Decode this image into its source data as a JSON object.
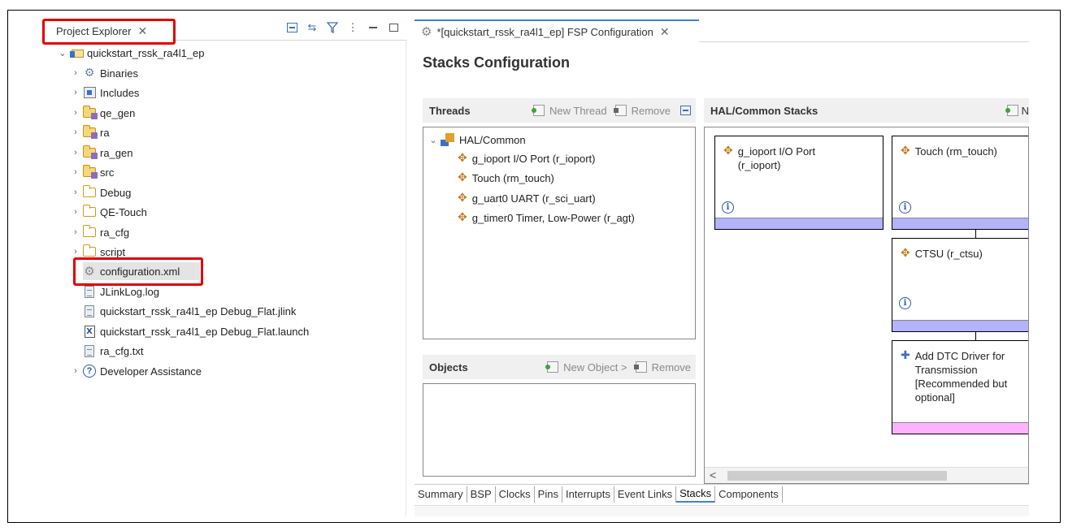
{
  "project_explorer": {
    "tab_label": "Project Explorer",
    "close_glyph": "✕",
    "toolbar_icons": [
      "collapse-all-icon",
      "link-with-editor-icon",
      "filter-icon",
      "view-menu-icon",
      "minimize-icon",
      "maximize-icon"
    ],
    "tree": [
      {
        "label": "quickstart_rssk_ra4l1_ep",
        "icon": "project-icon",
        "expanded": true
      },
      {
        "label": "Binaries",
        "icon": "binaries-icon"
      },
      {
        "label": "Includes",
        "icon": "includes-icon"
      },
      {
        "label": "qe_gen",
        "icon": "source-folder-icon"
      },
      {
        "label": "ra",
        "icon": "source-folder-icon"
      },
      {
        "label": "ra_gen",
        "icon": "source-folder-icon"
      },
      {
        "label": "src",
        "icon": "source-folder-icon"
      },
      {
        "label": "Debug",
        "icon": "folder-icon"
      },
      {
        "label": "QE-Touch",
        "icon": "folder-icon"
      },
      {
        "label": "ra_cfg",
        "icon": "folder-icon"
      },
      {
        "label": "script",
        "icon": "folder-icon"
      },
      {
        "label": "configuration.xml",
        "icon": "gear-icon",
        "selected": true
      },
      {
        "label": "JLinkLog.log",
        "icon": "file-icon"
      },
      {
        "label": "quickstart_rssk_ra4l1_ep Debug_Flat.jlink",
        "icon": "file-icon"
      },
      {
        "label": "quickstart_rssk_ra4l1_ep Debug_Flat.launch",
        "icon": "launch-file-icon"
      },
      {
        "label": "ra_cfg.txt",
        "icon": "file-icon"
      },
      {
        "label": "Developer Assistance",
        "icon": "help-icon"
      }
    ]
  },
  "editor": {
    "tab_label": "*[quickstart_rssk_ra4l1_ep] FSP Configuration",
    "close_glyph": "✕",
    "title": "Stacks Configuration",
    "threads": {
      "heading": "Threads",
      "new_thread": "New Thread",
      "remove": "Remove",
      "items": [
        {
          "label": "HAL/Common",
          "level": 0
        },
        {
          "label": "g_ioport I/O Port (r_ioport)",
          "level": 1
        },
        {
          "label": "Touch (rm_touch)",
          "level": 1
        },
        {
          "label": "g_uart0 UART (r_sci_uart)",
          "level": 1
        },
        {
          "label": "g_timer0 Timer, Low-Power (r_agt)",
          "level": 1
        }
      ]
    },
    "objects": {
      "heading": "Objects",
      "new_object": "New Object >",
      "remove": "Remove"
    },
    "hal_stacks": {
      "heading": "HAL/Common Stacks",
      "new_label": "N",
      "cards": [
        {
          "title_line1": "g_ioport I/O Port",
          "title_line2": "(r_ioport)",
          "bar_color": "#b3b3ff"
        },
        {
          "title_line1": "Touch (rm_touch)",
          "title_line2": "",
          "bar_color": "#b3b3ff"
        },
        {
          "title_line1": "CTSU (r_ctsu)",
          "title_line2": "",
          "bar_color": "#b3b3ff"
        },
        {
          "title_line1": "Add DTC Driver for",
          "title_line2": "Transmission",
          "title_line3": "[Recommended but",
          "title_line4": "optional]",
          "bar_color": "#ffb3ff"
        }
      ],
      "info_glyph": "i",
      "scroll_left": "<"
    },
    "bottom_tabs": [
      "Summary",
      "BSP",
      "Clocks",
      "Pins",
      "Interrupts",
      "Event Links",
      "Stacks",
      "Components"
    ],
    "active_bottom_tab": "Stacks"
  },
  "highlight_color": "#e00000",
  "accent_color": "#3c83ce"
}
